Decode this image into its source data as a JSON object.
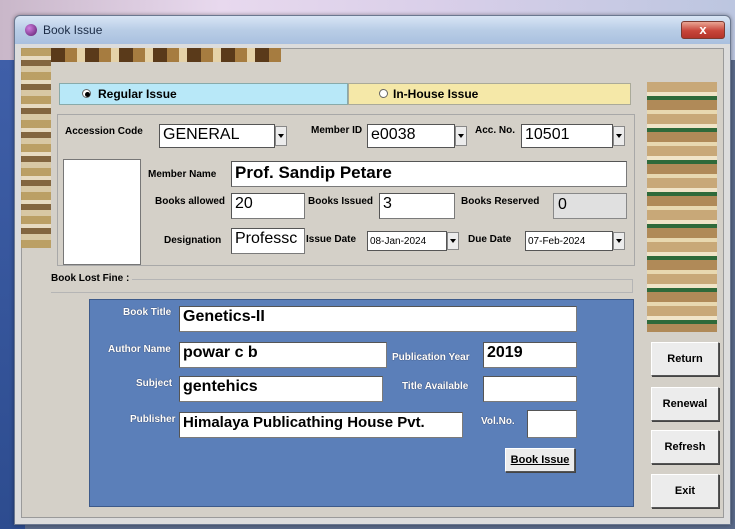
{
  "window": {
    "title": "Book Issue",
    "close_glyph": "x"
  },
  "issue_type": {
    "regular_label": "Regular Issue",
    "inhouse_label": "In-House Issue",
    "selected": "regular"
  },
  "accession_code": {
    "label": "Accession Code",
    "value": "GENERAL"
  },
  "member_id": {
    "label": "Member ID",
    "value": "e0038"
  },
  "acc_no": {
    "label": "Acc. No.",
    "value": "10501"
  },
  "member_name": {
    "label": "Member Name",
    "value": "Prof. Sandip Petare"
  },
  "books_allowed": {
    "label": "Books allowed",
    "value": "20"
  },
  "books_issued": {
    "label": "Books Issued",
    "value": "3"
  },
  "books_reserved": {
    "label": "Books Reserved",
    "value": "0"
  },
  "designation": {
    "label": "Designation",
    "value": "Professc"
  },
  "issue_date": {
    "label": "Issue Date",
    "value": "08-Jan-2024"
  },
  "due_date": {
    "label": "Due Date",
    "value": "07-Feb-2024"
  },
  "book_lost_fine": {
    "label": "Book Lost Fine :"
  },
  "book": {
    "title_label": "Book Title",
    "title": "Genetics-II",
    "author_label": "Author Name",
    "author": "powar c b",
    "pubyear_label": "Publication Year",
    "pubyear": "2019",
    "subject_label": "Subject",
    "subject": "gentehics",
    "title_avail_label": "Title Available",
    "title_avail": "",
    "publisher_label": "Publisher",
    "publisher": "Himalaya Publicathing House Pvt.",
    "volno_label": "Vol.No.",
    "volno": ""
  },
  "buttons": {
    "book_issue": "Book Issue",
    "return": "Return",
    "renewal": "Renewal",
    "refresh": "Refresh",
    "exit": "Exit"
  },
  "colors": {
    "regular_tab": "#b8e8f8",
    "inhouse_tab": "#f5e8a8",
    "book_panel": "#5b7fb9"
  }
}
